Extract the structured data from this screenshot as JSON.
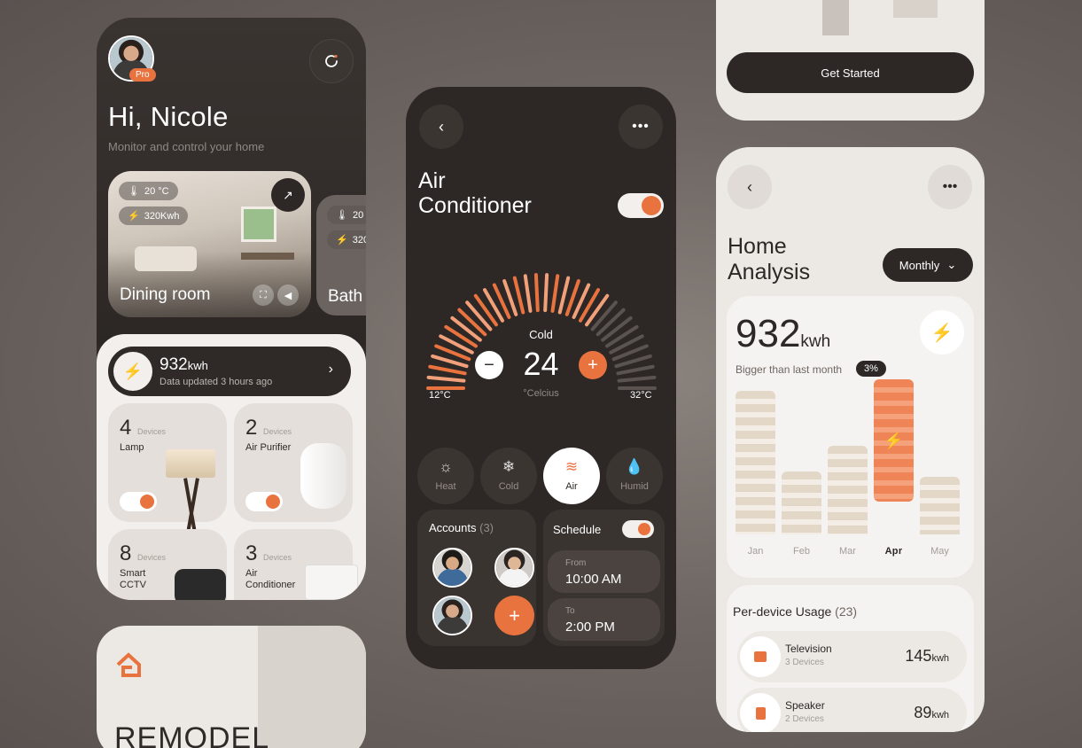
{
  "colors": {
    "accent": "#e9733f",
    "dark": "#2d2826",
    "light": "#ece8e4"
  },
  "home": {
    "badge": "Pro",
    "greeting": "Hi, Nicole",
    "subtitle": "Monitor and control your home",
    "rooms": [
      {
        "name": "Dining room",
        "temp": "20 °C",
        "energy": "320Kwh"
      },
      {
        "name": "Bath",
        "temp": "20",
        "energy": "320"
      }
    ],
    "energy": {
      "value": "932",
      "unit": "kwh",
      "updated": "Data updated 3 hours ago"
    },
    "devices": [
      {
        "count": "4",
        "label": "Devices",
        "name": "Lamp",
        "on": true
      },
      {
        "count": "2",
        "label": "Devices",
        "name": "Air Purifier",
        "on": true
      },
      {
        "count": "8",
        "label": "Devices",
        "name": "Smart CCTV"
      },
      {
        "count": "3",
        "label": "Devices",
        "name": "Air Conditioner"
      }
    ]
  },
  "remodel": {
    "text": "REMODEL"
  },
  "ac": {
    "title_line1": "Air",
    "title_line2": "Conditioner",
    "power_on": true,
    "mode_label": "Cold",
    "temperature": "24",
    "unit": "°Celcius",
    "min": "12°C",
    "max": "32°C",
    "level": 0.7,
    "modes": [
      {
        "label": "Heat",
        "icon": "sun-icon"
      },
      {
        "label": "Cold",
        "icon": "snowflake-icon"
      },
      {
        "label": "Air",
        "icon": "wind-icon",
        "selected": true
      },
      {
        "label": "Humid",
        "icon": "drop-icon"
      }
    ],
    "accounts": {
      "title": "Accounts",
      "count": "(3)"
    },
    "schedule": {
      "title": "Schedule",
      "enabled": true,
      "from_label": "From",
      "from": "10:00 AM",
      "to_label": "To",
      "to": "2:00 PM"
    }
  },
  "onboard": {
    "cta": "Get Started"
  },
  "analysis": {
    "title_line1": "Home",
    "title_line2": "Analysis",
    "period": "Monthly",
    "value": "932",
    "unit": "kwh",
    "compare": "Bigger than last month",
    "change": "3%",
    "per_device_title": "Per-device Usage",
    "per_device_count": "(23)",
    "devices": [
      {
        "name": "Television",
        "sub": "3 Devices",
        "value": "145",
        "unit": "kwh"
      },
      {
        "name": "Speaker",
        "sub": "2 Devices",
        "value": "89",
        "unit": "kwh"
      }
    ]
  },
  "chart_data": {
    "type": "bar",
    "categories": [
      "Jan",
      "Feb",
      "Mar",
      "Apr",
      "May"
    ],
    "values": [
      100,
      44,
      62,
      85,
      40
    ],
    "highlight": "Apr",
    "ylim": [
      0,
      100
    ],
    "title": "",
    "xlabel": "",
    "ylabel": ""
  }
}
